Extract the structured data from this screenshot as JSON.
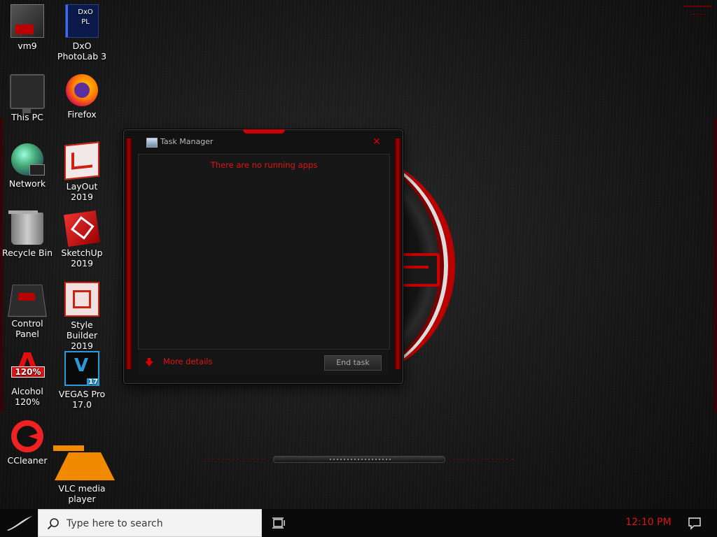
{
  "desktop": {
    "icons": [
      {
        "id": "vm9",
        "label": "vm9",
        "icon": "vm9-icon"
      },
      {
        "id": "dxo",
        "label": "DxO PhotoLab 3",
        "icon": "dxo-photolab-icon",
        "glyph": "DxO PL"
      },
      {
        "id": "thispc",
        "label": "This PC",
        "icon": "computer-icon"
      },
      {
        "id": "firefox",
        "label": "Firefox",
        "icon": "firefox-icon"
      },
      {
        "id": "network",
        "label": "Network",
        "icon": "network-globe-icon"
      },
      {
        "id": "layout",
        "label": "LayOut 2019",
        "icon": "layout-icon"
      },
      {
        "id": "recycle",
        "label": "Recycle Bin",
        "icon": "recycle-bin-icon"
      },
      {
        "id": "sketchup",
        "label": "SketchUp 2019",
        "icon": "sketchup-icon"
      },
      {
        "id": "controlpanel",
        "label": "Control Panel",
        "icon": "control-panel-icon"
      },
      {
        "id": "stylebuilder",
        "label": "Style Builder 2019",
        "icon": "style-builder-icon"
      },
      {
        "id": "alcohol",
        "label": "Alcohol 120%",
        "icon": "alcohol-120-icon"
      },
      {
        "id": "vegas",
        "label": "VEGAS Pro 17.0",
        "icon": "vegas-pro-icon"
      },
      {
        "id": "ccleaner",
        "label": "CCleaner",
        "icon": "ccleaner-icon"
      },
      {
        "id": "vlc",
        "label": "VLC media player",
        "icon": "vlc-cone-icon"
      }
    ]
  },
  "task_manager": {
    "title": "Task Manager",
    "empty_message": "There are no running apps",
    "more_details_label": "More details",
    "end_task_label": "End task",
    "close_glyph": "✕"
  },
  "taskbar": {
    "search_placeholder": "Type here to search",
    "clock": "12:10 PM"
  },
  "colors": {
    "accent_red": "#e01414",
    "frame_red": "#b00000",
    "background_dark": "#141414"
  }
}
